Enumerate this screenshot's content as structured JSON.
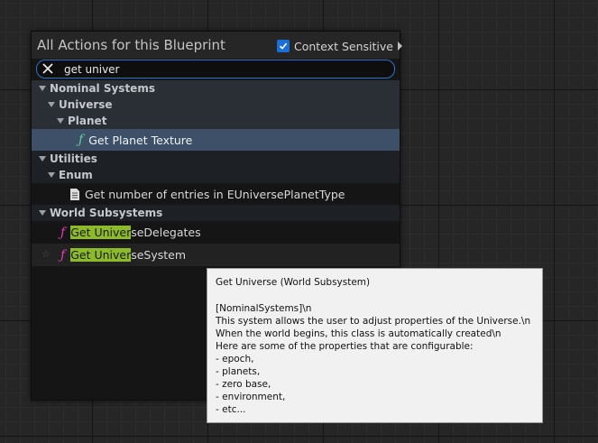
{
  "panel": {
    "title": "All Actions for this Blueprint",
    "context_sensitive_label": "Context Sensitive",
    "context_sensitive_checked": true
  },
  "search": {
    "value": "get univer"
  },
  "tree": {
    "cat_nominal": "Nominal Systems",
    "cat_universe": "Universe",
    "cat_planet": "Planet",
    "item_planet_texture": "Get Planet Texture",
    "cat_utilities": "Utilities",
    "cat_enum": "Enum",
    "item_enum_entries": "Get number of entries in EUniversePlanetType",
    "cat_world": "World Subsystems",
    "item_delegates_match": "Get Univer",
    "item_delegates_rest": "seDelegates",
    "item_system_match": "Get Univer",
    "item_system_rest": "seSystem"
  },
  "tooltip": {
    "title": "Get Universe (World Subsystem)",
    "lines": [
      "[NominalSystems]\\n",
      "This system allows the user to adjust properties of the Universe.\\n",
      "When the world begins, this class is automatically created\\n",
      "Here are some of the properties that are configurable:",
      "- epoch,",
      "- planets,",
      "- zero base,",
      "- environment,",
      "- etc..."
    ]
  },
  "colors": {
    "highlight": "#8dba2a",
    "selected_row": "#3d5068",
    "search_border": "#2f72c9",
    "function_green": "#5ccfa0",
    "function_pink": "#e03fb5"
  },
  "icons": {
    "clear": "close-icon",
    "checkbox": "checkmark-icon",
    "expand": "chevron-right-icon",
    "collapse": "triangle-down-icon",
    "function": "function-icon",
    "document": "document-icon",
    "favorite": "star-icon"
  }
}
